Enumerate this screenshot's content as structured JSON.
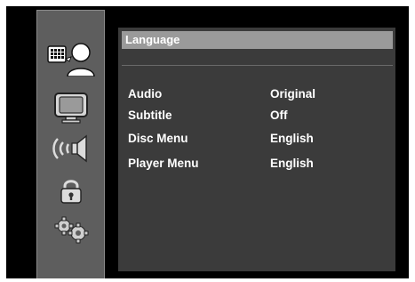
{
  "sidebar": {
    "items": [
      {
        "icon": "language-icon",
        "selected": true
      },
      {
        "icon": "display-icon"
      },
      {
        "icon": "audio-icon"
      },
      {
        "icon": "lock-icon"
      },
      {
        "icon": "settings-icon"
      }
    ]
  },
  "panel": {
    "title": "Language",
    "rows": [
      {
        "label": "Audio",
        "value": "Original"
      },
      {
        "label": "Subtitle",
        "value": "Off"
      },
      {
        "label": "Disc Menu",
        "value": "English"
      },
      {
        "label": "Player Menu",
        "value": "English"
      }
    ]
  },
  "colors": {
    "background": "#000000",
    "sidebar": "#5e5e5e",
    "panel": "#3b3b3b",
    "title_bar": "#9a9a9a"
  }
}
